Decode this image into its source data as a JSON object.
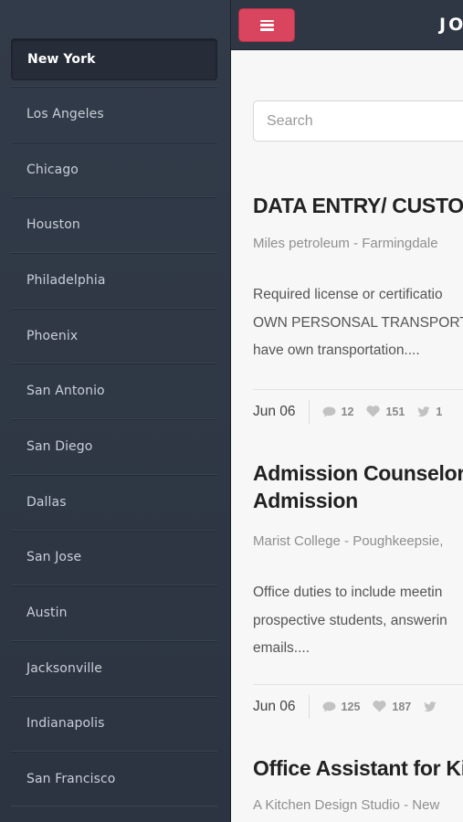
{
  "sidebar": {
    "items": [
      {
        "label": "New York",
        "active": true
      },
      {
        "label": "Los Angeles"
      },
      {
        "label": "Chicago"
      },
      {
        "label": "Houston"
      },
      {
        "label": "Philadelphia"
      },
      {
        "label": "Phoenix"
      },
      {
        "label": "San Antonio"
      },
      {
        "label": "San Diego"
      },
      {
        "label": "Dallas"
      },
      {
        "label": "San Jose"
      },
      {
        "label": "Austin"
      },
      {
        "label": "Jacksonville"
      },
      {
        "label": "Indianapolis"
      },
      {
        "label": "San Francisco"
      }
    ]
  },
  "topbar": {
    "brand": "JO"
  },
  "search": {
    "placeholder": "Search"
  },
  "jobs": [
    {
      "title_lines": [
        "DATA ENTRY/ CUSTOM"
      ],
      "company": "Miles petroleum - Farmingdale",
      "desc_lines": [
        "Required license or certificatio",
        "OWN PERSONSAL TRANSPORT",
        "have own transportation...."
      ],
      "date": "Jun 06",
      "comments": "12",
      "likes": "151",
      "shares": "1"
    },
    {
      "title_lines": [
        "Admission Counselor/",
        "Admission"
      ],
      "company": "Marist College - Poughkeepsie,",
      "desc_lines": [
        "Office duties to include meetin",
        "prospective students, answerin",
        "emails...."
      ],
      "date": "Jun 06",
      "comments": "125",
      "likes": "187",
      "shares": ""
    },
    {
      "title_lines": [
        "Office Assistant for Kit"
      ],
      "company": "A Kitchen Design Studio - New"
    }
  ],
  "colors": {
    "sidebar_bg": "#2f3745",
    "accent": "#d9455f",
    "main_bg": "#f7f7f7"
  },
  "icons": {
    "menu": "hamburger-icon",
    "comment": "comment-icon",
    "like": "heart-icon",
    "share": "twitter-icon"
  }
}
